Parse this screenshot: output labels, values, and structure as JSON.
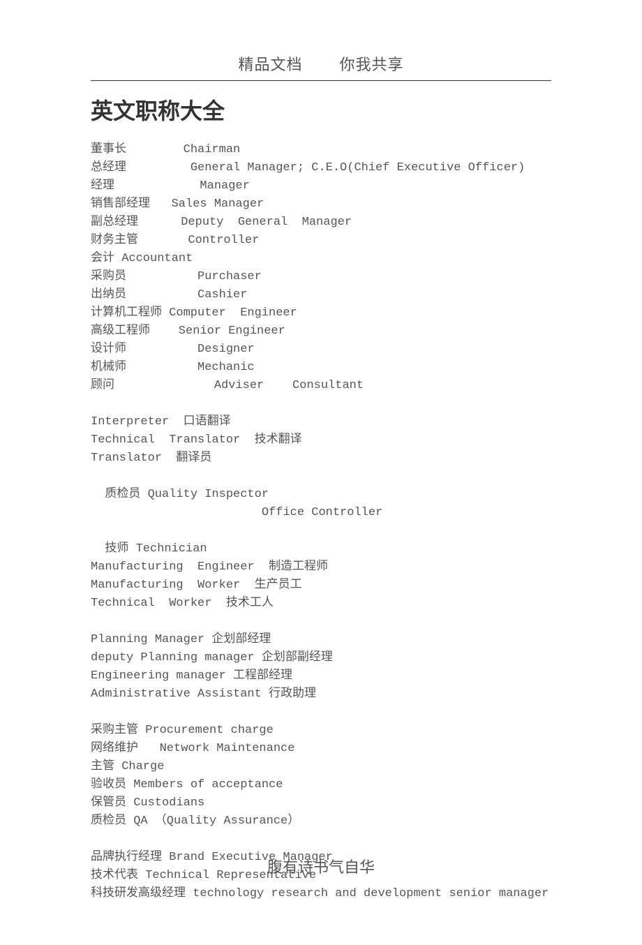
{
  "header": {
    "left": "精品文档",
    "right": "你我共享"
  },
  "title": "英文职称大全",
  "lines": [
    "董事长        Chairman",
    "总经理         General Manager; C.E.O(Chief Executive Officer)",
    "经理            Manager",
    "销售部经理   Sales Manager",
    "副总经理      Deputy  General  Manager",
    "财务主管       Controller",
    "会计 Accountant",
    "采购员          Purchaser",
    "出纳员          Cashier",
    "计算机工程师 Computer  Engineer",
    "高级工程师    Senior Engineer",
    "设计师          Designer",
    "机械师          Mechanic",
    "顾问              Adviser    Consultant",
    "",
    "Interpreter  口语翻译",
    "Technical  Translator  技术翻译",
    "Translator  翻译员",
    "",
    "  质检员 Quality Inspector",
    "                        Office Controller",
    "",
    "  技师 Technician",
    "Manufacturing  Engineer  制造工程师",
    "Manufacturing  Worker  生产员工",
    "Technical  Worker  技术工人",
    "",
    "Planning Manager 企划部经理",
    "deputy Planning manager 企划部副经理",
    "Engineering manager 工程部经理",
    "Administrative Assistant 行政助理",
    "",
    "采购主管 Procurement charge",
    "网络维护   Network Maintenance",
    "主管 Charge",
    "验收员 Members of acceptance",
    "保管员 Custodians",
    "质检员 QA （Quality Assurance）",
    "",
    "品牌执行经理 Brand Executive Manager",
    "技术代表 Technical Representative",
    "科技研发高级经理 technology research and development senior manager"
  ],
  "footer": "腹有诗书气自华"
}
